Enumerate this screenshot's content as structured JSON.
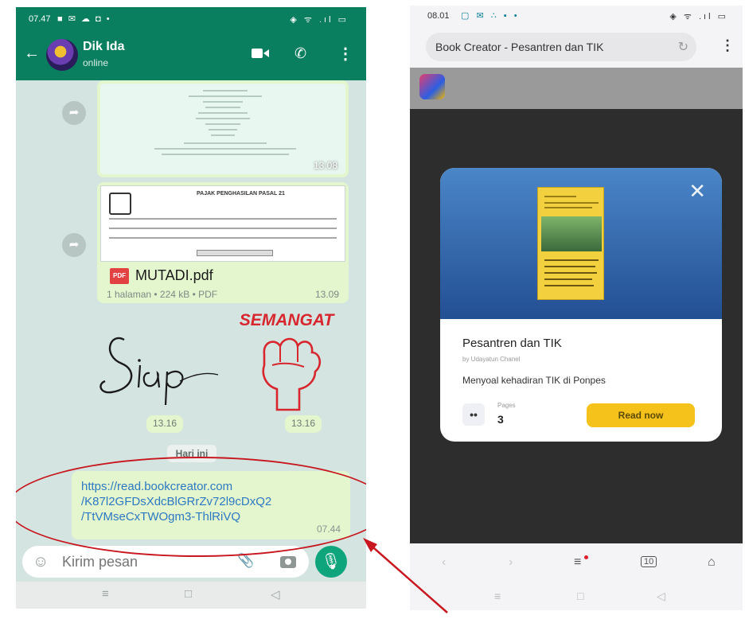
{
  "whatsapp": {
    "status_time": "07.47",
    "contact_name": "Dik Ida",
    "contact_status": "online",
    "doc1_time": "13.08",
    "doc2_header": "PAJAK PENGHASILAN PASAL 21",
    "pdf_name": "MUTADI.pdf",
    "pdf_meta": "1 halaman • 224 kB • PDF",
    "pdf_time": "13.09",
    "sticker_siap": "Siap",
    "sticker_semangat": "SEMANGAT",
    "sticker_time_1": "13.16",
    "sticker_time_2": "13.16",
    "date_separator": "Hari ini",
    "link_lines": [
      "https://read.bookcreator.com",
      "/K87l2GFDsXdcBlGRrZv72l9cDxQ2",
      "/TtVMseCxTWOgm3-ThlRiVQ"
    ],
    "link_time": "07.44",
    "input_placeholder": "Kirim pesan"
  },
  "browser": {
    "status_time": "08.01",
    "tab_title": "Book Creator - Pesantren dan TIK",
    "book": {
      "title": "Pesantren dan TIK",
      "author": "by Udayatun Chanel",
      "description": "Menyoal kehadiran TIK di Ponpes",
      "pages_label": "Pages",
      "pages_count": "3",
      "read_button": "Read now"
    },
    "tab_count": "10"
  }
}
